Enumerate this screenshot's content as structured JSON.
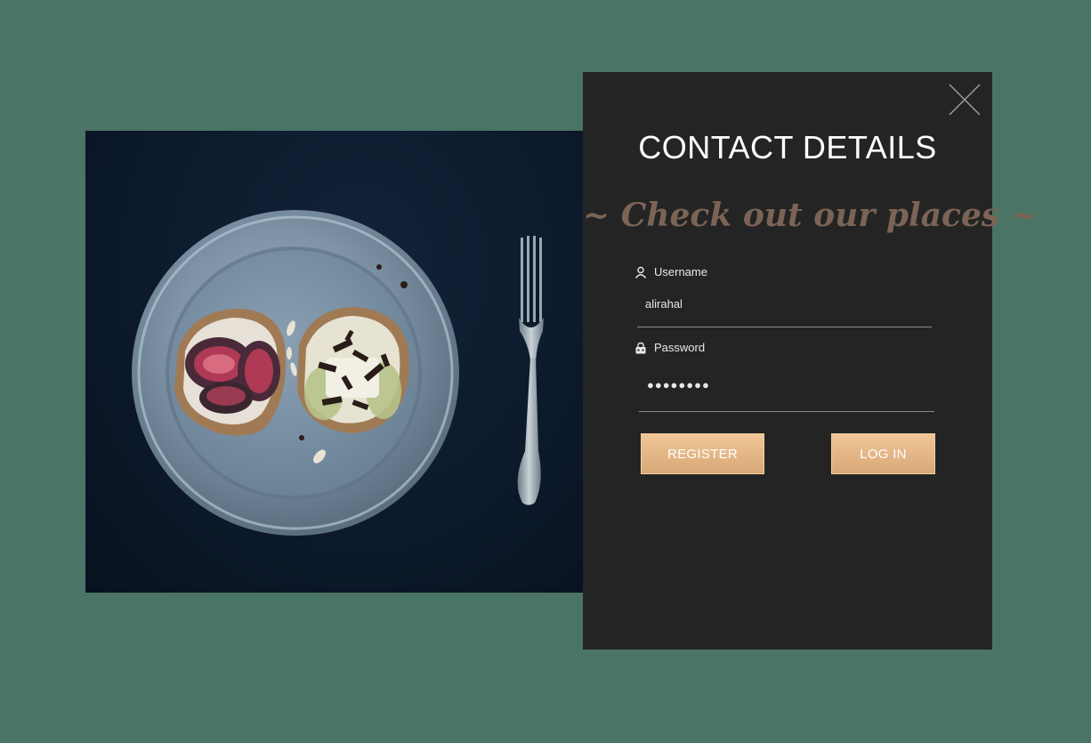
{
  "dialog": {
    "title": "CONTACT DETAILS",
    "tagline": "~ Check out our places ~"
  },
  "form": {
    "username": {
      "label": "Username",
      "value": "alirahal",
      "icon": "user-icon"
    },
    "password": {
      "label": "Password",
      "masked_value": "●●●●●●●●",
      "icon": "lock-icon"
    }
  },
  "buttons": {
    "register_label": "REGISTER",
    "login_label": "LOG IN"
  },
  "colors": {
    "background": "#4a7466",
    "panel": "#242424",
    "accent": "#e8b888",
    "tagline": "#7b6456"
  }
}
